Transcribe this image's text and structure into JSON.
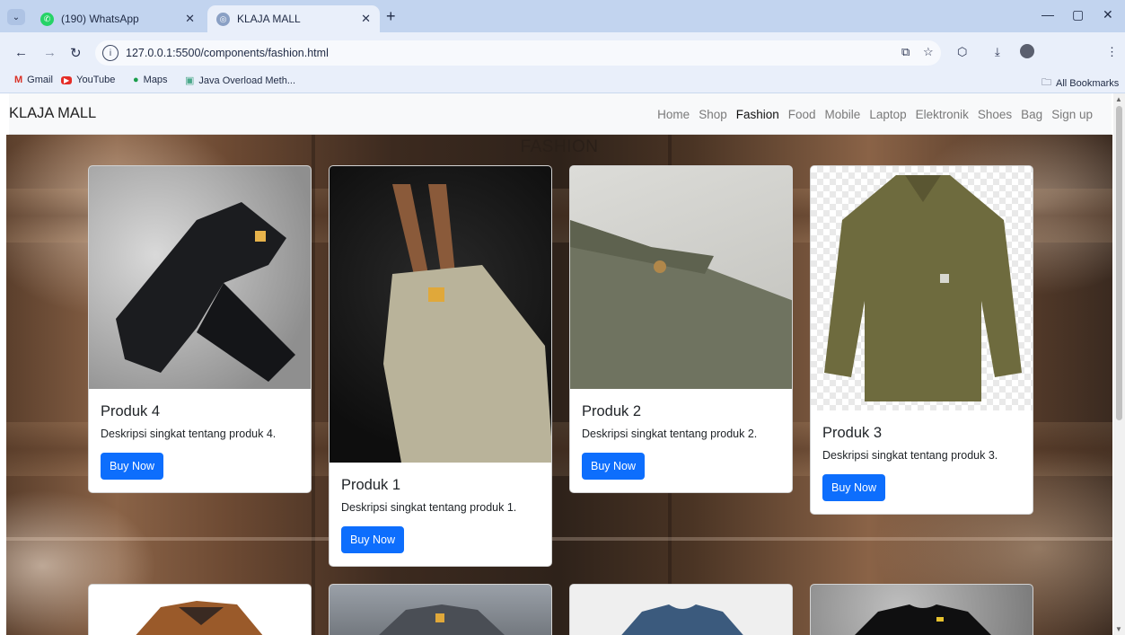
{
  "browser": {
    "tabs": [
      {
        "title": "(190) WhatsApp",
        "active": false
      },
      {
        "title": "KLAJA MALL",
        "active": true
      }
    ],
    "url": "127.0.0.1:5500/components/fashion.html",
    "bookmarks": [
      {
        "label": "Gmail"
      },
      {
        "label": "YouTube"
      },
      {
        "label": "Maps"
      },
      {
        "label": "Java Overload Meth..."
      }
    ],
    "all_bookmarks": "All Bookmarks"
  },
  "site": {
    "brand": "KLAJA MALL",
    "nav": [
      {
        "label": "Home",
        "active": false
      },
      {
        "label": "Shop",
        "active": false
      },
      {
        "label": "Fashion",
        "active": true
      },
      {
        "label": "Food",
        "active": false
      },
      {
        "label": "Mobile",
        "active": false
      },
      {
        "label": "Laptop",
        "active": false
      },
      {
        "label": "Elektronik",
        "active": false
      },
      {
        "label": "Shoes",
        "active": false
      },
      {
        "label": "Bag",
        "active": false
      },
      {
        "label": "Sign up",
        "active": false
      }
    ],
    "section_title": "FASHION",
    "products": [
      {
        "name": "Produk 4",
        "description": "Deskripsi singkat tentang produk 4.",
        "button": "Buy Now",
        "image": "black-cargo-pants"
      },
      {
        "name": "Produk 1",
        "description": "Deskripsi singkat tentang produk 1.",
        "button": "Buy Now",
        "image": "beige-overalls"
      },
      {
        "name": "Produk 2",
        "description": "Deskripsi singkat tentang produk 2.",
        "button": "Buy Now",
        "image": "olive-work-pants"
      },
      {
        "name": "Produk 3",
        "description": "Deskripsi singkat tentang produk 3.",
        "button": "Buy Now",
        "image": "olive-shirt-jacket"
      }
    ],
    "next_row_images": [
      "brown-jacket",
      "grey-jacket",
      "blue-tshirt",
      "black-sweatshirt"
    ]
  },
  "colors": {
    "primary_button": "#0d6efd",
    "navbar_bg": "#f8f9fa",
    "browser_chrome": "#c2d4ef"
  }
}
